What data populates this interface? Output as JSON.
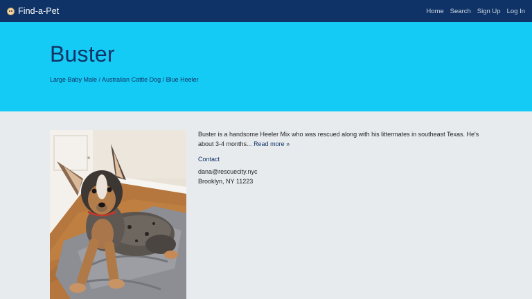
{
  "navbar": {
    "brand": "Find-a-Pet",
    "brand_icon": "dog-face-icon",
    "links": [
      "Home",
      "Search",
      "Sign Up",
      "Log In"
    ],
    "background": "#0f3366"
  },
  "hero": {
    "title": "Buster",
    "subtitle": "Large Baby Male / Australian Cattle Dog / Blue Heeler",
    "background": "#14cbf5"
  },
  "pet": {
    "description": "Buster is a handsome Heeler Mix who was rescued along with his littermates in southeast Texas. He's about 3-4 months...",
    "read_more": "Read more »",
    "contact_label": "Contact",
    "email": "dana@rescuecity.nyc",
    "location": "Brooklyn, NY 11223"
  },
  "colors": {
    "page_background": "#e8ebee",
    "link": "#0f3366"
  }
}
